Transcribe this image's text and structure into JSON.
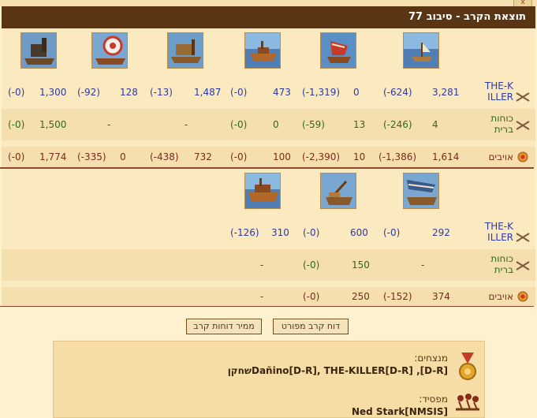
{
  "window": {
    "title": "תוצאת הקרב - סיבוב 77",
    "close_glyph": "x"
  },
  "section1": {
    "units": [
      "unit-1",
      "unit-2",
      "unit-3",
      "unit-4",
      "unit-5",
      "unit-6"
    ],
    "player": {
      "name": "THE-KILLER",
      "cells": [
        {
          "value": "3,281",
          "loss": "(-624)"
        },
        {
          "value": "0",
          "loss": "(-1,319)"
        },
        {
          "value": "473",
          "loss": "(-0)"
        },
        {
          "value": "1,487",
          "loss": "(-13)"
        },
        {
          "value": "128",
          "loss": "(-92)"
        },
        {
          "value": "1,300",
          "loss": "(-0)"
        }
      ]
    },
    "allies": {
      "name": "כוחות ברית",
      "cells": [
        {
          "value": "4",
          "loss": "(-246)"
        },
        {
          "value": "13",
          "loss": "(-59)"
        },
        {
          "value": "0",
          "loss": "(-0)"
        },
        {
          "value": "-",
          "loss": ""
        },
        {
          "value": "-",
          "loss": ""
        },
        {
          "value": "1,500",
          "loss": "(-0)"
        }
      ]
    },
    "enemies": {
      "name": "אויבים",
      "cells": [
        {
          "value": "1,614",
          "loss": "(-1,386)"
        },
        {
          "value": "10",
          "loss": "(-2,390)"
        },
        {
          "value": "100",
          "loss": "(-0)"
        },
        {
          "value": "732",
          "loss": "(-438)"
        },
        {
          "value": "0",
          "loss": "(-335)"
        },
        {
          "value": "1,774",
          "loss": "(-0)"
        }
      ]
    }
  },
  "section2": {
    "player": {
      "name": "THE-KILLER",
      "cells": [
        {
          "value": "292",
          "loss": "(-0)"
        },
        {
          "value": "600",
          "loss": "(-0)"
        },
        {
          "value": "310",
          "loss": "(-126)"
        }
      ]
    },
    "allies": {
      "name": "כוחות ברית",
      "cells": [
        {
          "value": "-",
          "loss": ""
        },
        {
          "value": "150",
          "loss": "(-0)"
        },
        {
          "value": "-",
          "loss": ""
        }
      ]
    },
    "enemies": {
      "name": "אויבים",
      "cells": [
        {
          "value": "374",
          "loss": "(-152)"
        },
        {
          "value": "250",
          "loss": "(-0)"
        },
        {
          "value": "-",
          "loss": ""
        }
      ]
    }
  },
  "buttons": {
    "detailed_report": "דוח קרב מפורט",
    "convert_reports": "ממיר דוחות קרב"
  },
  "result": {
    "winners_label": "מנצחים:",
    "winners_value": "Dañino[D-R], THE-KILLER[D-R] ,[D-R]שחקן",
    "loser_label": "מפסיד:",
    "loser_value": "Ned Stark[NMSIS]"
  },
  "colors": {
    "title_bg": "#5a3514",
    "panel_bg": "#fbe9c0",
    "band_bg": "#f6dfae",
    "separator": "#8a4a2a",
    "value_blue": "#2e3aa6",
    "allies_green": "#2e6a1d"
  },
  "icons": {
    "row_player": "crossed-swords-icon",
    "row_allies": "crossed-swords-icon",
    "row_enemies": "enemy-emblem-icon",
    "winners": "medal-icon",
    "loser": "fallen-soldiers-icon"
  }
}
